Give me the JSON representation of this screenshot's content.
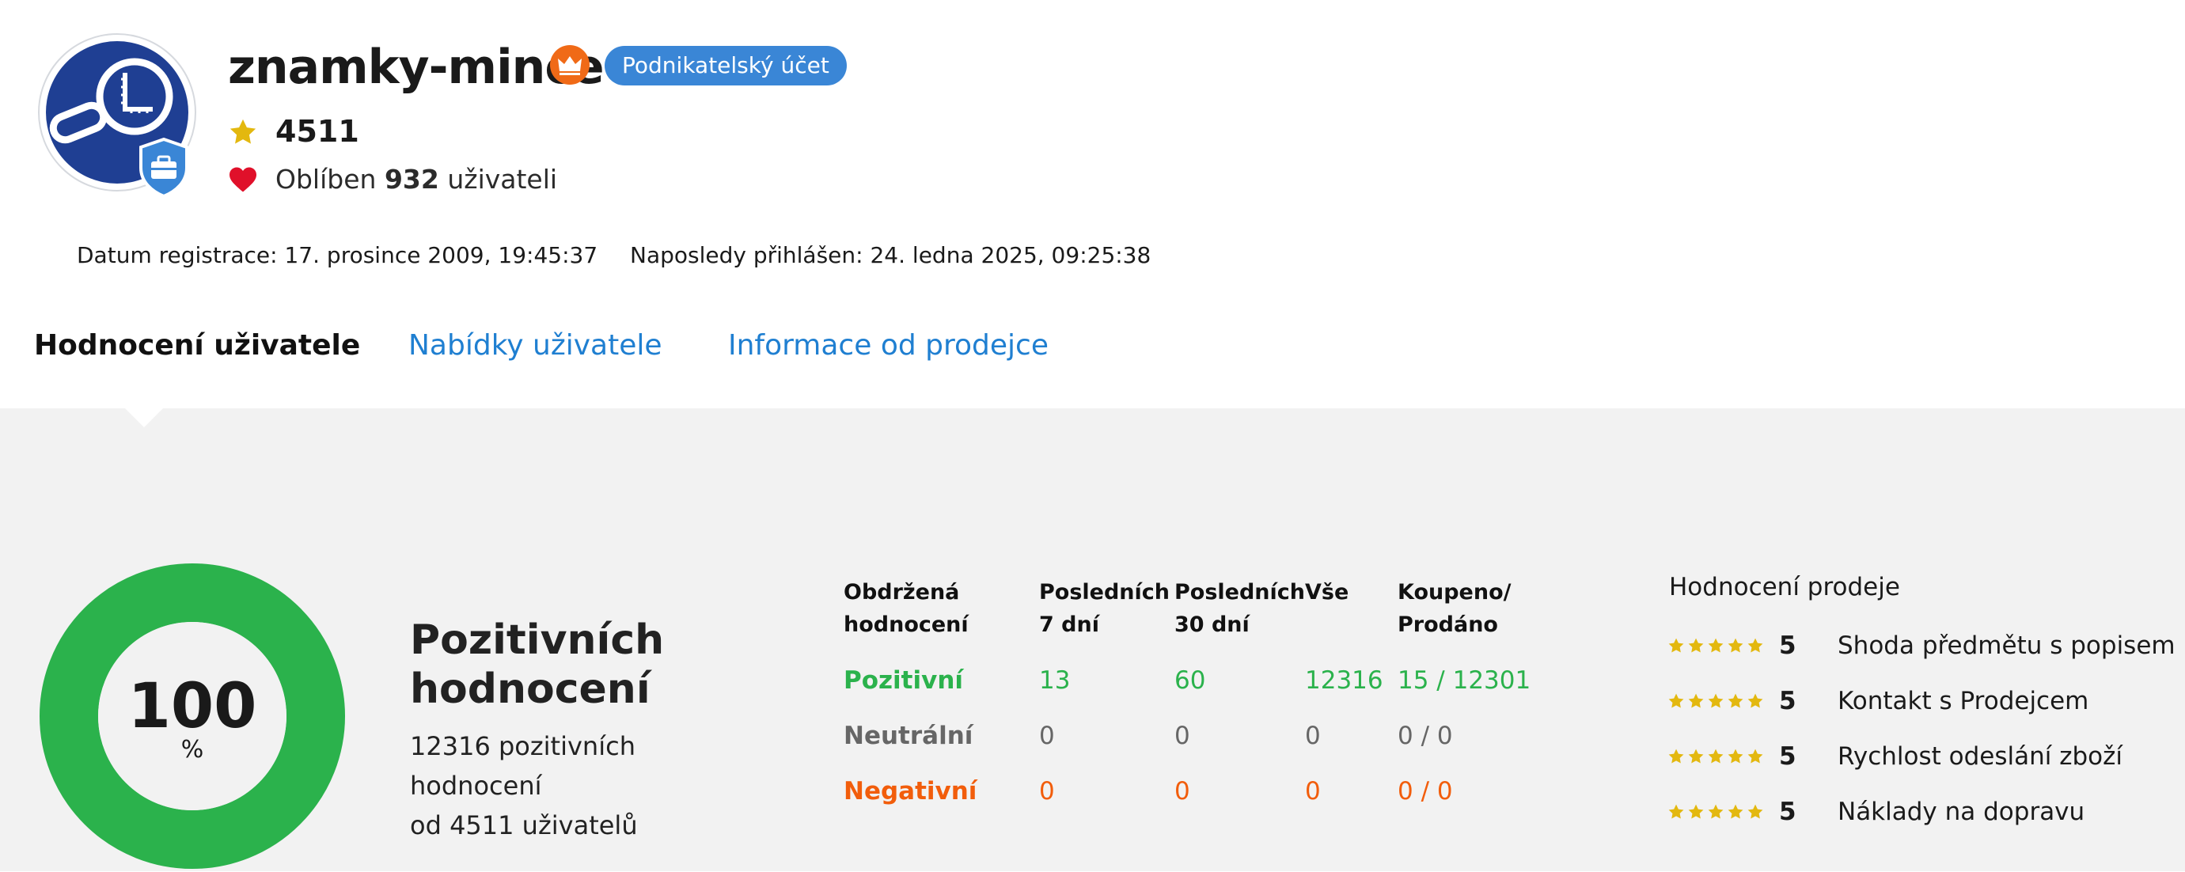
{
  "profile": {
    "username": "znamky-mince",
    "account_badge": "Podnikatelský účet",
    "rating": "4511",
    "favorite_prefix": "Oblíben",
    "favorite_count": "932",
    "favorite_suffix": "uživateli",
    "registration": "Datum registrace: 17. prosince 2009, 19:45:37",
    "last_login": "Naposledy přihlášen: 24. ledna 2025, 09:25:38"
  },
  "tabs": [
    {
      "label": "Hodnocení uživatele",
      "active": true
    },
    {
      "label": "Nabídky uživatele",
      "active": false
    },
    {
      "label": "Informace od prodejce",
      "active": false
    }
  ],
  "summary": {
    "percent": "100",
    "percent_sign": "%",
    "percent_value": 100,
    "title_line1": "Pozitivních",
    "title_line2": "hodnocení",
    "sub_line1": "12316 pozitivních hodnocení",
    "sub_line2": "od 4511 uživatelů"
  },
  "ratings_table": {
    "headers": [
      [
        "Obdržená",
        "hodnocení"
      ],
      [
        "Posledních",
        "7 dní"
      ],
      [
        "Posledních",
        "30 dní"
      ],
      [
        "Vše",
        ""
      ],
      [
        "Koupeno/",
        "Prodáno"
      ]
    ],
    "rows": [
      {
        "label": "Pozitivní",
        "d7": "13",
        "d30": "60",
        "all": "12316",
        "bought_sold": "15 / 12301"
      },
      {
        "label": "Neutrální",
        "d7": "0",
        "d30": "0",
        "all": "0",
        "bought_sold": "0 / 0"
      },
      {
        "label": "Negativní",
        "d7": "0",
        "d30": "0",
        "all": "0",
        "bought_sold": "0 / 0"
      }
    ]
  },
  "sale_rating": {
    "title": "Hodnocení prodeje",
    "items": [
      {
        "stars": 5,
        "value": "5",
        "label": "Shoda předmětu s popisem"
      },
      {
        "stars": 5,
        "value": "5",
        "label": "Kontakt s Prodejcem"
      },
      {
        "stars": 5,
        "value": "5",
        "label": "Rychlost odeslání zboží"
      },
      {
        "stars": 5,
        "value": "5",
        "label": "Náklady na dopravu"
      }
    ]
  },
  "colors": {
    "positive": "#2bb24c",
    "neutral": "#666666",
    "negative": "#f25d0b",
    "link": "#1f7fd1",
    "badge": "#3a86d6",
    "crown": "#f06a17",
    "star": "#e3b80f",
    "heart": "#e0102a"
  },
  "icons": [
    "magnifier-stamp-logo",
    "briefcase-icon",
    "crown-icon",
    "star-icon",
    "heart-icon"
  ]
}
